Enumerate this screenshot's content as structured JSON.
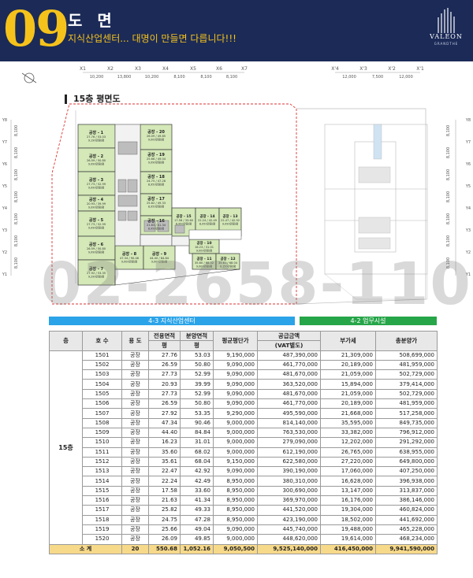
{
  "header": {
    "number": "09",
    "title": "도 면",
    "subtitle": "지식산업센터... 대명이 만들면 다릅니다!!!",
    "logo_name": "VALEON",
    "logo_sub": "GRANDTHE"
  },
  "plan": {
    "section_label": "15층 평면도",
    "top_dims": [
      "10,200",
      "13,800",
      "10,200",
      "8,100",
      "8,100",
      "8,100"
    ],
    "top_axes": [
      "X1",
      "X2",
      "X3",
      "X4",
      "X5",
      "X6",
      "X7"
    ],
    "right_top_dims": [
      "12,000",
      "7,500",
      "12,000"
    ],
    "right_top_axes": [
      "X'4",
      "X'3",
      "X'2",
      "X'1"
    ],
    "side_dims": [
      "8,100",
      "8,100",
      "8,100",
      "8,100",
      "8,100",
      "8,100",
      "8,100"
    ],
    "side_axes": [
      "Y8",
      "Y7",
      "Y6",
      "Y5",
      "Y4",
      "Y3",
      "Y2",
      "Y1"
    ],
    "rooms": [
      {
        "name": "공장 - 1",
        "area": "27.76 / 53.03",
        "price": "9,190만원/평"
      },
      {
        "name": "공장 - 2",
        "area": "26.59 / 50.80",
        "price": "9,090만원/평"
      },
      {
        "name": "공장 - 3",
        "area": "27.73 / 52.99",
        "price": "9,090만원/평"
      },
      {
        "name": "공장 - 4",
        "area": "20.93 / 39.99",
        "price": "9,090만원/평"
      },
      {
        "name": "공장 - 5",
        "area": "27.73 / 52.99",
        "price": "9,090만원/평"
      },
      {
        "name": "공장 - 6",
        "area": "26.59 / 50.80",
        "price": "9,090만원/평"
      },
      {
        "name": "공장 - 7",
        "area": "27.92 / 53.35",
        "price": "9,290만원/평"
      },
      {
        "name": "공장 - 8",
        "area": "47.34 / 90.46",
        "price": "9,000만원/평"
      },
      {
        "name": "공장 - 9",
        "area": "44.40 / 84.84",
        "price": "9,000만원/평"
      },
      {
        "name": "공장 - 10",
        "area": "16.23 / 31.01",
        "price": "9,000만원/평"
      },
      {
        "name": "공장 - 11",
        "area": "35.60 / 68.02",
        "price": "9,000만원/평"
      },
      {
        "name": "공장 - 12",
        "area": "35.61 / 68.04",
        "price": "9,150만원/평"
      },
      {
        "name": "공장 - 13",
        "area": "22.47 / 42.92",
        "price": "9,090만원/평"
      },
      {
        "name": "공장 - 14",
        "area": "22.24 / 42.49",
        "price": "8,950만원/평"
      },
      {
        "name": "공장 - 15",
        "area": "17.58 / 33.60",
        "price": "8,950만원/평"
      },
      {
        "name": "공장 - 16",
        "area": "21.63 / 41.34",
        "price": "8,950만원/평"
      },
      {
        "name": "공장 - 17",
        "area": "25.82 / 49.33",
        "price": "8,950만원/평"
      },
      {
        "name": "공장 - 18",
        "area": "24.75 / 47.28",
        "price": "8,950만원/평"
      },
      {
        "name": "공장 - 19",
        "area": "25.66 / 49.04",
        "price": "9,090만원/평"
      },
      {
        "name": "공장 - 20",
        "area": "26.09 / 49.85",
        "price": "9,000만원/평"
      }
    ]
  },
  "watermark": "02-2658-1104",
  "zones": {
    "left": "4-3 지식산업센터",
    "right": "4-2 업무시설"
  },
  "table": {
    "headers": {
      "floor": "층",
      "unit": "호 수",
      "use": "용 도",
      "exclusive_top": "전용면적",
      "exclusive_unit": "평",
      "sale_top": "분양면적",
      "sale_unit": "평",
      "avg_price": "평균평단가",
      "supply_top": "공급금액",
      "supply_sub": "(VAT별도)",
      "vat": "부가세",
      "total": "총분양가"
    },
    "floor_label": "15층",
    "rows": [
      [
        "1501",
        "공장",
        "27.76",
        "53.03",
        "9,190,000",
        "487,390,000",
        "21,309,000",
        "508,699,000"
      ],
      [
        "1502",
        "공장",
        "26.59",
        "50.80",
        "9,090,000",
        "461,770,000",
        "20,189,000",
        "481,959,000"
      ],
      [
        "1503",
        "공장",
        "27.73",
        "52.99",
        "9,090,000",
        "481,670,000",
        "21,059,000",
        "502,729,000"
      ],
      [
        "1504",
        "공장",
        "20.93",
        "39.99",
        "9,090,000",
        "363,520,000",
        "15,894,000",
        "379,414,000"
      ],
      [
        "1505",
        "공장",
        "27.73",
        "52.99",
        "9,090,000",
        "481,670,000",
        "21,059,000",
        "502,729,000"
      ],
      [
        "1506",
        "공장",
        "26.59",
        "50.80",
        "9,090,000",
        "461,770,000",
        "20,189,000",
        "481,959,000"
      ],
      [
        "1507",
        "공장",
        "27.92",
        "53.35",
        "9,290,000",
        "495,590,000",
        "21,668,000",
        "517,258,000"
      ],
      [
        "1508",
        "공장",
        "47.34",
        "90.46",
        "9,000,000",
        "814,140,000",
        "35,595,000",
        "849,735,000"
      ],
      [
        "1509",
        "공장",
        "44.40",
        "84.84",
        "9,000,000",
        "763,530,000",
        "33,382,000",
        "796,912,000"
      ],
      [
        "1510",
        "공장",
        "16.23",
        "31.01",
        "9,000,000",
        "279,090,000",
        "12,202,000",
        "291,292,000"
      ],
      [
        "1511",
        "공장",
        "35.60",
        "68.02",
        "9,000,000",
        "612,190,000",
        "26,765,000",
        "638,955,000"
      ],
      [
        "1512",
        "공장",
        "35.61",
        "68.04",
        "9,150,000",
        "622,580,000",
        "27,220,000",
        "649,800,000"
      ],
      [
        "1513",
        "공장",
        "22.47",
        "42.92",
        "9,090,000",
        "390,190,000",
        "17,060,000",
        "407,250,000"
      ],
      [
        "1514",
        "공장",
        "22.24",
        "42.49",
        "8,950,000",
        "380,310,000",
        "16,628,000",
        "396,938,000"
      ],
      [
        "1515",
        "공장",
        "17.58",
        "33.60",
        "8,950,000",
        "300,690,000",
        "13,147,000",
        "313,837,000"
      ],
      [
        "1516",
        "공장",
        "21.63",
        "41.34",
        "8,950,000",
        "369,970,000",
        "16,176,000",
        "386,146,000"
      ],
      [
        "1517",
        "공장",
        "25.82",
        "49.33",
        "8,950,000",
        "441,520,000",
        "19,304,000",
        "460,824,000"
      ],
      [
        "1518",
        "공장",
        "24.75",
        "47.28",
        "8,950,000",
        "423,190,000",
        "18,502,000",
        "441,692,000"
      ],
      [
        "1519",
        "공장",
        "25.66",
        "49.04",
        "9,090,000",
        "445,740,000",
        "19,488,000",
        "465,228,000"
      ],
      [
        "1520",
        "공장",
        "26.09",
        "49.85",
        "9,000,000",
        "448,620,000",
        "19,614,000",
        "468,234,000"
      ]
    ],
    "total": {
      "label": "소  계",
      "count": "20",
      "exclusive": "550.68",
      "sale": "1,052.16",
      "avg_price": "9,050,500",
      "supply": "9,525,140,000",
      "vat": "416,450,000",
      "total": "9,941,590,000"
    }
  }
}
